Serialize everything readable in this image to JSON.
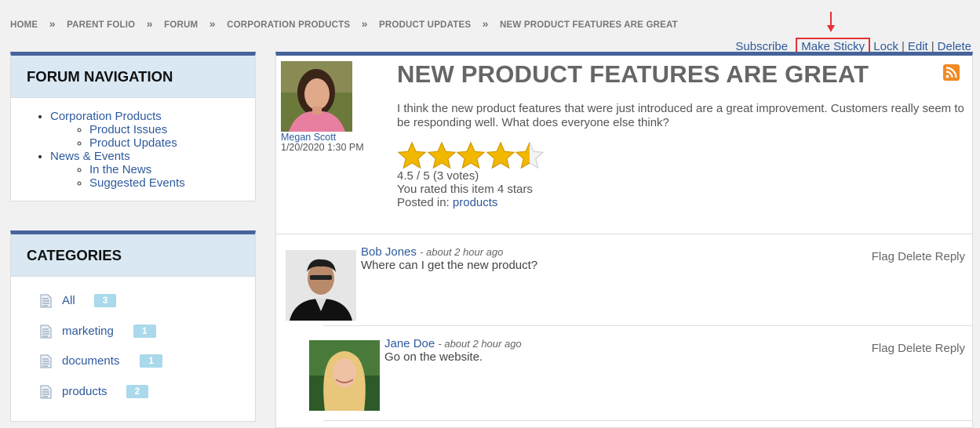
{
  "breadcrumb": [
    "HOME",
    "PARENT FOLIO",
    "FORUM",
    "CORPORATION PRODUCTS",
    "PRODUCT UPDATES",
    "NEW PRODUCT FEATURES ARE GREAT"
  ],
  "breadcrumb_separator": "»",
  "actions": {
    "subscribe": "Subscribe",
    "make_sticky": "Make Sticky",
    "lock": "Lock",
    "edit": "Edit",
    "delete": "Delete",
    "separator": "|"
  },
  "forum_navigation": {
    "title": "FORUM NAVIGATION",
    "items": [
      {
        "label": "Corporation Products",
        "children": [
          "Product Issues",
          "Product Updates"
        ]
      },
      {
        "label": "News & Events",
        "children": [
          "In the News",
          "Suggested Events"
        ]
      }
    ]
  },
  "categories": {
    "title": "CATEGORIES",
    "items": [
      {
        "label": "All",
        "count": "3"
      },
      {
        "label": "marketing",
        "count": "1"
      },
      {
        "label": "documents",
        "count": "1"
      },
      {
        "label": "products",
        "count": "2"
      }
    ]
  },
  "post": {
    "title": "NEW PRODUCT FEATURES ARE GREAT",
    "author": "Megan Scott",
    "date": "1/20/2020 1:30 PM",
    "body": "I think the new product features that were just introduced are a great improvement. Customers really seem to be responding well. What does everyone else think?",
    "rating_value": 4.5,
    "rating_max": 5,
    "rating_text": "4.5 / 5 (3 votes)",
    "user_rating": "You rated this item 4 stars",
    "posted_in_label": "Posted in:",
    "posted_in_link": "products"
  },
  "comments": [
    {
      "author": "Bob Jones",
      "time": "about 2 hour ago",
      "text": "Where can I get the new product?"
    },
    {
      "author": "Jane Doe",
      "time": "about 2 hour ago",
      "text": "Go on the website."
    }
  ],
  "comment_controls": {
    "flag": "Flag",
    "delete": "Delete",
    "reply": "Reply"
  },
  "icons": {
    "rss": "rss-icon",
    "document": "document-icon",
    "arrow": "arrow-down-icon",
    "star": "star-icon"
  },
  "colors": {
    "accent": "#46639a",
    "link": "#2e5a9c",
    "highlight": "#e53238",
    "panel_header": "#d9e8f3",
    "badge": "#a9d9ea",
    "star": "#f2b800"
  }
}
